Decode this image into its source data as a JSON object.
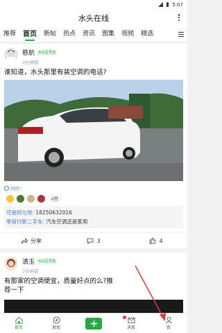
{
  "status": {
    "time": "5:07"
  },
  "appbar": {
    "title": "水头在线"
  },
  "tabs": [
    "推荐",
    "首页",
    "新帖",
    "热点",
    "资讯",
    "图集",
    "视频",
    "精选"
  ],
  "posts": [
    {
      "author": "慈航",
      "badge": "水头区号加",
      "time": "3分钟前",
      "title": "谁知道，水头那里有装空调的电话?",
      "question_tag": "问问",
      "like_count": "4赞",
      "comments": [
        {
          "author": "可是阿七呀:",
          "text": "18250632016"
        },
        {
          "author": "零首付新二手车:",
          "text": "汽车空调还是家用"
        }
      ],
      "actions": {
        "share": "分享",
        "comment": "3",
        "like": "4"
      }
    },
    {
      "author": "清玉",
      "badge": "水头区号加",
      "time": "3分钟前",
      "title": "有那家的空调便宜，质量好点的么?推荐一下"
    }
  ],
  "bottom_nav": [
    "首页",
    "发现",
    "",
    "消息",
    "我"
  ],
  "colors": {
    "accent": "#22aa46",
    "link": "#4b7bd8",
    "arrow": "#e53935"
  }
}
